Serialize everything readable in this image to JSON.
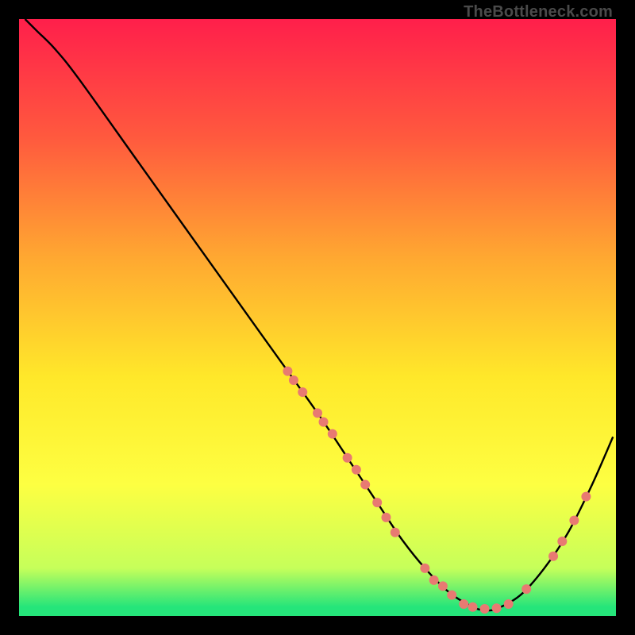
{
  "attribution": "TheBottleneck.com",
  "chart_data": {
    "type": "line",
    "title": "",
    "xlabel": "",
    "ylabel": "",
    "xlim": [
      0,
      100
    ],
    "ylim": [
      0,
      100
    ],
    "grid": false,
    "legend": false,
    "background_gradient_stops": [
      {
        "offset": 0.0,
        "color": "#ff1f4b"
      },
      {
        "offset": 0.2,
        "color": "#ff5a3e"
      },
      {
        "offset": 0.4,
        "color": "#ffa831"
      },
      {
        "offset": 0.6,
        "color": "#ffe82a"
      },
      {
        "offset": 0.78,
        "color": "#fdff42"
      },
      {
        "offset": 0.92,
        "color": "#c6ff5a"
      },
      {
        "offset": 0.985,
        "color": "#25e57a"
      }
    ],
    "series": [
      {
        "name": "bottleneck-curve",
        "color": "#000000",
        "x": [
          1,
          3,
          6,
          10,
          20,
          30,
          40,
          50,
          56,
          60,
          64,
          68,
          72,
          76,
          78,
          80,
          84,
          88,
          92,
          96,
          99.5
        ],
        "y": [
          100,
          98,
          95,
          90,
          76,
          62,
          48,
          34,
          25,
          19,
          13,
          8,
          4,
          1.5,
          1,
          1.2,
          3.5,
          8,
          14,
          22,
          30
        ]
      }
    ],
    "markers": {
      "color": "#e87a72",
      "radius": 6,
      "points": [
        {
          "x": 45,
          "y": 41
        },
        {
          "x": 46,
          "y": 39.5
        },
        {
          "x": 47.5,
          "y": 37.5
        },
        {
          "x": 50,
          "y": 34
        },
        {
          "x": 51,
          "y": 32.5
        },
        {
          "x": 52.5,
          "y": 30.5
        },
        {
          "x": 55,
          "y": 26.5
        },
        {
          "x": 56.5,
          "y": 24.5
        },
        {
          "x": 58,
          "y": 22
        },
        {
          "x": 60,
          "y": 19
        },
        {
          "x": 61.5,
          "y": 16.5
        },
        {
          "x": 63,
          "y": 14
        },
        {
          "x": 68,
          "y": 8
        },
        {
          "x": 69.5,
          "y": 6
        },
        {
          "x": 71,
          "y": 5
        },
        {
          "x": 72.5,
          "y": 3.5
        },
        {
          "x": 74.5,
          "y": 2
        },
        {
          "x": 76,
          "y": 1.5
        },
        {
          "x": 78,
          "y": 1.2
        },
        {
          "x": 80,
          "y": 1.3
        },
        {
          "x": 82,
          "y": 2
        },
        {
          "x": 85,
          "y": 4.5
        },
        {
          "x": 89.5,
          "y": 10
        },
        {
          "x": 91,
          "y": 12.5
        },
        {
          "x": 93,
          "y": 16
        },
        {
          "x": 95,
          "y": 20
        }
      ]
    }
  }
}
